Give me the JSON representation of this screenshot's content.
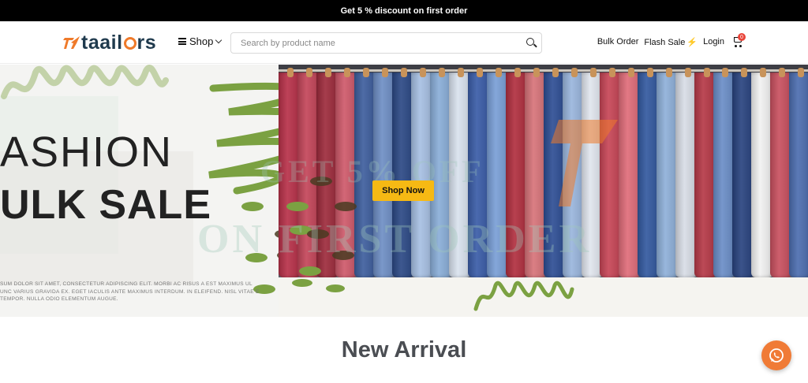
{
  "promo_bar": {
    "text": "Get 5 % discount on first order"
  },
  "header": {
    "brand": {
      "part1": "taail",
      "part2": "rs",
      "icon": "tailor-t-logo-icon"
    },
    "shop_menu": {
      "label": "Shop",
      "icon": "hamburger-menu-icon",
      "chevron": "chevron-down-icon"
    },
    "search": {
      "placeholder": "Search by product name",
      "value": "",
      "icon": "search-icon"
    },
    "nav": {
      "bulk_order": "Bulk Order",
      "flash_sale": "Flash Sale",
      "flash_icon": "⚡",
      "login": "Login",
      "cart_count": "0",
      "cart_icon": "cart-icon"
    }
  },
  "banner": {
    "headline_1": "ASHION",
    "headline_2": "ULK SALE",
    "body_text": "SUM DOLOR SIT AMET, CONSECTETUR ADIPISCING ELIT. MORBI AC RISUS A EST MAXIMUS UL UNC VARIUS GRAVIDA EX. EGET IACULIS ANTE MAXIMUS INTERDUM. IN ELEIFEND. NISL VITAE E TEMPOR. NULLA ODIO ELEMENTUM AUGUE.",
    "cta": "Shop Now",
    "watermark_1": "GET 5% OFF",
    "watermark_2": "ON FIRST ORDER",
    "accent_color": "#7ba142",
    "shirt_colors": [
      "#b8324a",
      "#c4465a",
      "#9e2c3d",
      "#cf5a6b",
      "#3f5f9e",
      "#6f8fc5",
      "#2d4a86",
      "#a7c0e3",
      "#8aaed8",
      "#d9e2ee",
      "#3b5da8",
      "#7a9fd6",
      "#b13040",
      "#d7747a",
      "#2f4f95",
      "#9ab6dd",
      "#e1e6ee",
      "#c74657",
      "#e06d7a",
      "#345aa0",
      "#8fb0d9",
      "#d8dde6",
      "#b63a48",
      "#6b8ec7",
      "#2a4480",
      "#f2f2f2",
      "#c95160",
      "#4d6eb0"
    ]
  },
  "main": {
    "section_title": "New Arrival"
  },
  "whatsapp": {
    "icon": "whatsapp-icon"
  },
  "colors": {
    "brand_orange": "#ef7a2a",
    "cta_yellow": "#f6b914",
    "badge_red": "#e9453a"
  }
}
